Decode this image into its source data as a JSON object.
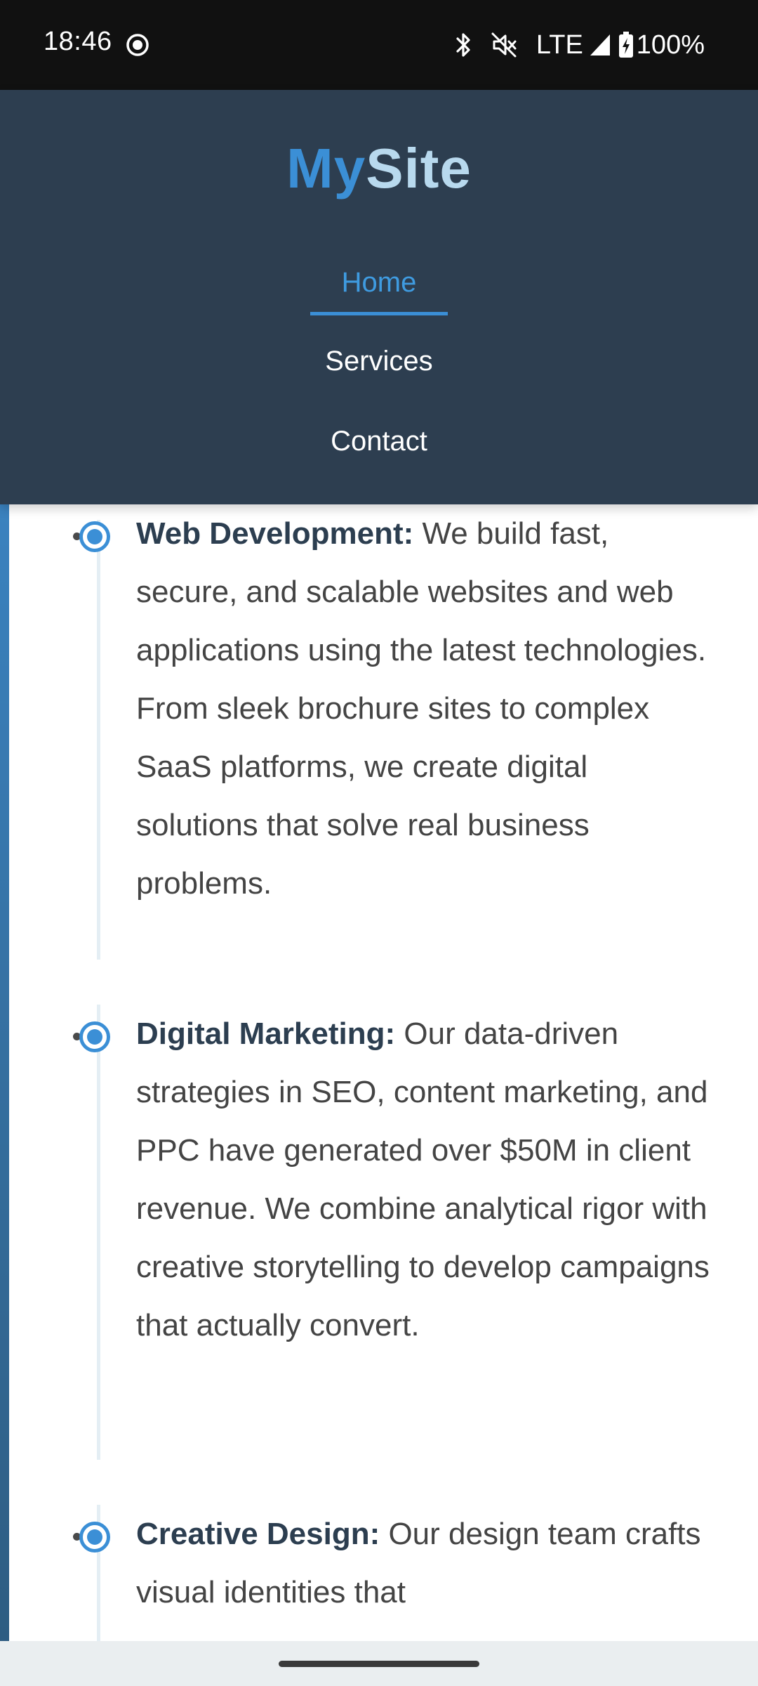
{
  "status_bar": {
    "time": "18:46",
    "network": "LTE",
    "battery": "100%",
    "icons": [
      "record-icon",
      "bluetooth-icon",
      "mute-icon",
      "signal-icon",
      "battery-icon"
    ]
  },
  "header": {
    "logo_part1": "My",
    "logo_part2": "Site",
    "nav": [
      {
        "label": "Home",
        "active": true
      },
      {
        "label": "Services",
        "active": false
      },
      {
        "label": "Contact",
        "active": false
      }
    ]
  },
  "services": [
    {
      "title": "Web Development:",
      "description": " We build fast, secure, and scalable websites and web applications using the latest technologies. From sleek brochure sites to complex SaaS platforms, we create digital solutions that solve real business problems."
    },
    {
      "title": "Digital Marketing:",
      "description": " Our data-driven strategies in SEO, content marketing, and PPC have generated over $50M in client revenue. We combine analytical rigor with creative storytelling to develop campaigns that actually convert."
    },
    {
      "title": "Creative Design:",
      "description": " Our design team crafts visual identities that"
    }
  ],
  "colors": {
    "header_bg": "#2d3e50",
    "accent": "#3b8fd6",
    "logo_light": "#b8d9ee",
    "title_text": "#2c3e50",
    "body_text": "#444444"
  }
}
